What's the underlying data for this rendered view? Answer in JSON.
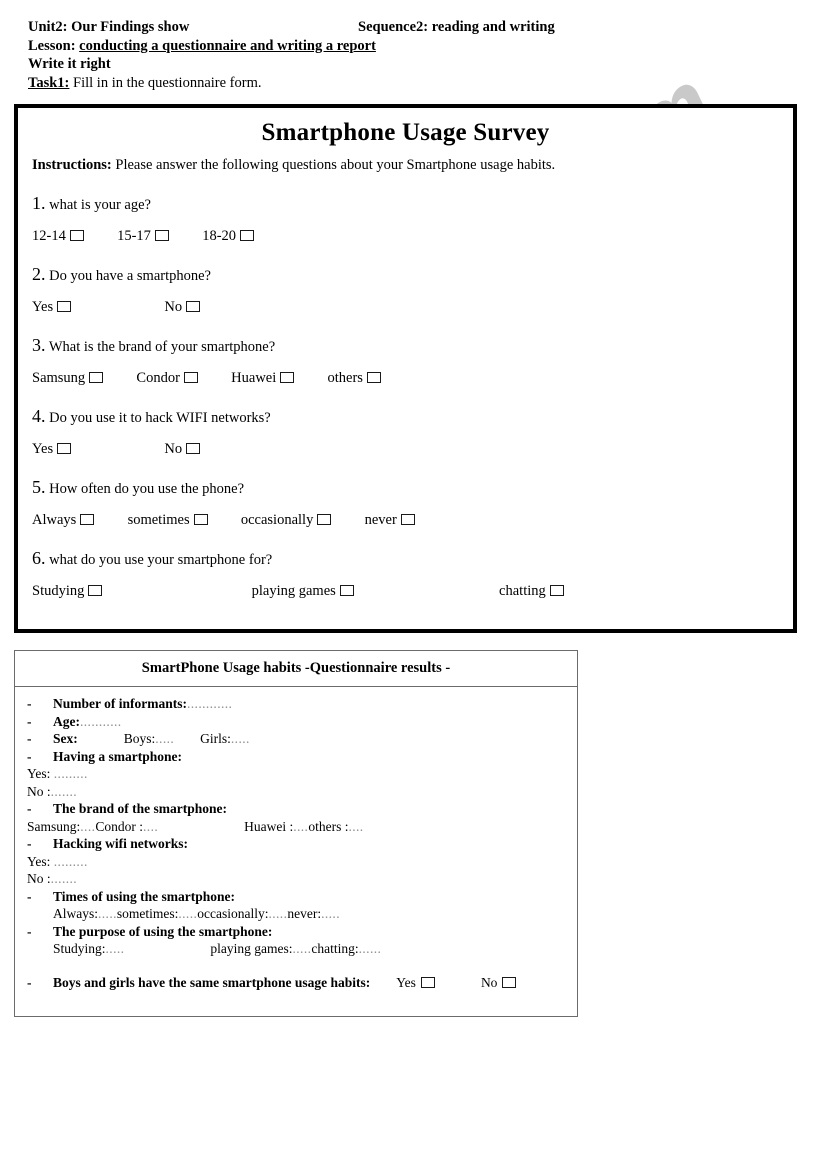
{
  "header": {
    "unit": "Unit2: Our Findings show",
    "sequence": "Sequence2: reading and writing",
    "lesson_label": "Lesson:",
    "lesson_value": "conducting a questionnaire and writing a report",
    "write_it_right": "Write it right",
    "task_label": "Task1:",
    "task_value": "Fill in in the questionnaire form."
  },
  "watermark": {
    "text": "ESLprintables.com",
    "color": "#c9c9c9"
  },
  "survey": {
    "title": "Smartphone Usage Survey",
    "instructions_label": "Instructions:",
    "instructions_text": "Please answer the following questions about your Smartphone usage habits.",
    "questions": [
      {
        "number": "1.",
        "text": "what is your age?",
        "options": [
          "12-14",
          "15-17",
          "18-20"
        ]
      },
      {
        "number": "2.",
        "text": "Do you have a smartphone?",
        "options": [
          "Yes",
          "No"
        ]
      },
      {
        "number": "3.",
        "text": "What is the brand of your smartphone?",
        "options": [
          "Samsung",
          "Condor",
          "Huawei",
          "others"
        ]
      },
      {
        "number": "4.",
        "text": "Do you use it to hack WIFI networks?",
        "options": [
          "Yes",
          "No"
        ]
      },
      {
        "number": "5.",
        "text": "How often do you use the phone?",
        "options": [
          "Always",
          "sometimes",
          "occasionally",
          "never"
        ]
      },
      {
        "number": "6.",
        "text": "what do you use your smartphone for?",
        "options": [
          "Studying",
          "playing games",
          "chatting"
        ]
      }
    ]
  },
  "results": {
    "title": "SmartPhone Usage habits -Questionnaire results -",
    "bullet": "-",
    "items": {
      "informants_label": "Number of informants:",
      "informants_dots": "............",
      "age_label": "Age:",
      "age_dots": "...........",
      "sex_label": "Sex:",
      "sex_boys": "Boys:",
      "sex_boys_dots": ".....",
      "sex_girls": "Girls:",
      "sex_girls_dots": ".....",
      "having_label": "Having a smartphone:",
      "having_yes": "Yes:",
      "having_yes_dots": ".........",
      "having_no": "No :",
      "having_no_dots": ".......",
      "brand_label": "The brand of the smartphone:",
      "brand_samsung": "Samsung:",
      "brand_samsung_dots": "....",
      "brand_condor": "Condor :",
      "brand_condor_dots": "....",
      "brand_huawei": "Huawei :",
      "brand_huawei_dots": "....",
      "brand_others": "others :",
      "brand_others_dots": "....",
      "hacking_label": "Hacking wifi networks:",
      "hacking_yes": "Yes:",
      "hacking_yes_dots": ".........",
      "hacking_no": "No :",
      "hacking_no_dots": ".......",
      "times_label": "Times of using the smartphone:",
      "times_always": "Always:",
      "times_always_dots": ".....",
      "times_sometimes": "sometimes:",
      "times_sometimes_dots": ".....",
      "times_occasionally": "occasionally:",
      "times_occasionally_dots": ".....",
      "times_never": "never:",
      "times_never_dots": ".....",
      "purpose_label": "The purpose of using the smartphone:",
      "purpose_studying": "Studying:",
      "purpose_studying_dots": ".....",
      "purpose_games": "playing games:",
      "purpose_games_dots": ".....",
      "purpose_chatting": "chatting:",
      "purpose_chatting_dots": "......",
      "final_label": "Boys and girls have the same smartphone usage habits:",
      "final_yes": "Yes",
      "final_no": "No"
    }
  }
}
